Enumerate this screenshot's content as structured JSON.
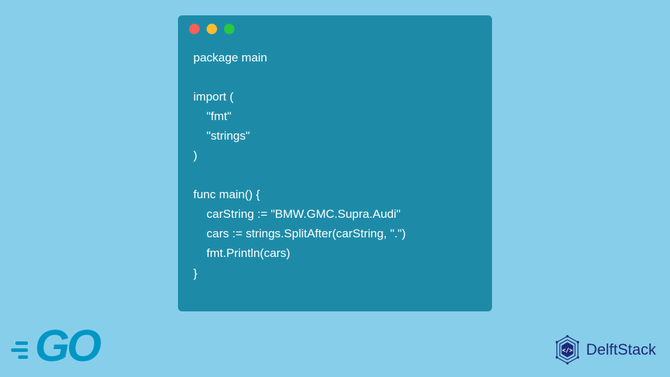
{
  "code": {
    "lines": [
      "package main",
      "",
      "import (",
      "    \"fmt\"",
      "    \"strings\"",
      ")",
      "",
      "func main() {",
      "    carString := \"BMW.GMC.Supra.Audi\"",
      "    cars := strings.SplitAfter(carString, \".\")",
      "    fmt.Println(cars)",
      "}"
    ]
  },
  "logos": {
    "go": "GO",
    "delft": "DelftStack"
  },
  "colors": {
    "page_bg": "#87ceeb",
    "window_bg": "#1d8ba8",
    "code_fg": "#ffffff",
    "go_logo": "#0097c4",
    "delft_logo": "#1b2a7a",
    "dot_red": "#ff5f56",
    "dot_yellow": "#ffbd2e",
    "dot_green": "#27c93f"
  }
}
